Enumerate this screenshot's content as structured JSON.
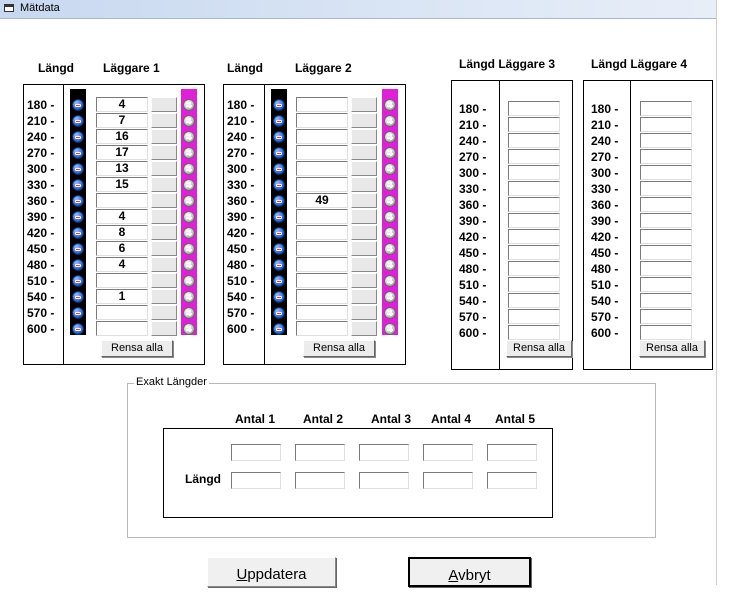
{
  "window": {
    "title": "Mätdata"
  },
  "lengths": [
    "180 -",
    "210 -",
    "240 -",
    "270 -",
    "300 -",
    "330 -",
    "360 -",
    "390 -",
    "420 -",
    "450 -",
    "480 -",
    "510 -",
    "540 -",
    "570 -",
    "600 -"
  ],
  "headers": {
    "langd": "Längd",
    "p1": "Läggare 1",
    "p2": "Läggare 2",
    "p3": "Längd Läggare 3",
    "p4": "Längd Läggare 4"
  },
  "panel1": {
    "values": [
      "4",
      "7",
      "16",
      "17",
      "13",
      "15",
      "",
      "4",
      "8",
      "6",
      "4",
      "",
      "1",
      "",
      ""
    ]
  },
  "panel2": {
    "values": [
      "",
      "",
      "",
      "",
      "",
      "",
      "49",
      "",
      "",
      "",
      "",
      "",
      "",
      "",
      ""
    ]
  },
  "panel3": {
    "values": [
      "",
      "",
      "",
      "",
      "",
      "",
      "",
      "",
      "",
      "",
      "",
      "",
      "",
      "",
      ""
    ]
  },
  "panel4": {
    "values": [
      "",
      "",
      "",
      "",
      "",
      "",
      "",
      "",
      "",
      "",
      "",
      "",
      "",
      "",
      ""
    ]
  },
  "clear_all_label": "Rensa alla",
  "exakt": {
    "title": "Exakt Längder",
    "columns": [
      "Antal 1",
      "Antal 2",
      "Antal 3",
      "Antal 4",
      "Antal 5"
    ],
    "row_label": "Längd"
  },
  "buttons": {
    "update_accel": "U",
    "update_rest": "ppdatera",
    "cancel_accel": "A",
    "cancel_rest": "vbryt"
  },
  "colors": {
    "plus_column": "#e020d8",
    "minus_column": "#000000"
  }
}
